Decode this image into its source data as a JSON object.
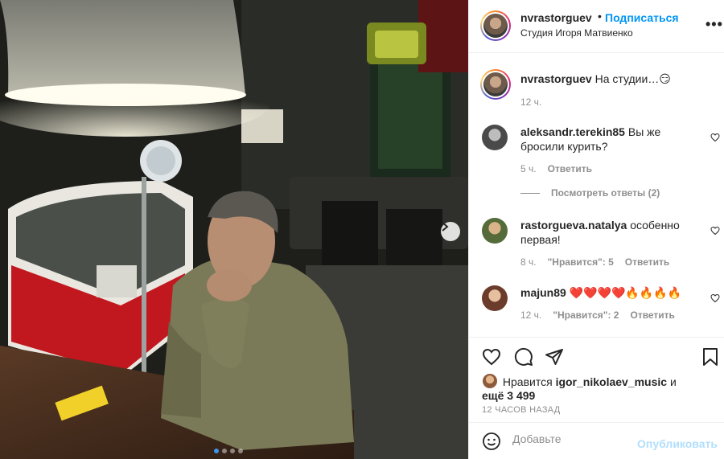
{
  "post": {
    "username": "nvrastorguev",
    "follow_label": "Подписаться",
    "separator": "•",
    "location": "Студия Игоря Матвиенко",
    "more_label": "•••"
  },
  "caption": {
    "username": "nvrastorguev",
    "text": "На студии…",
    "emoji": "😏",
    "time": "12 ч."
  },
  "comments": [
    {
      "username": "aleksandr.terekin85",
      "text": "Вы же бросили курить?",
      "time": "5 ч.",
      "reply_label": "Ответить",
      "view_replies": "Посмотреть ответы (2)"
    },
    {
      "username": "rastorgueva.natalya",
      "text": "особенно первая!",
      "time": "8 ч.",
      "likes": "\"Нравится\": 5",
      "reply_label": "Ответить"
    },
    {
      "username": "majun89",
      "text": "❤️❤️❤️❤️🔥🔥🔥🔥",
      "time": "12 ч.",
      "likes": "\"Нравится\": 2",
      "reply_label": "Ответить"
    }
  ],
  "likes": {
    "prefix": "Нравится",
    "user": "igor_nikolaev_music",
    "and": "и",
    "more": "ещё 3 499"
  },
  "time_ago": "12 ЧАСОВ НАЗАД",
  "add_comment": {
    "placeholder": "Добавьте",
    "publish_label": "Опубликовать"
  },
  "carousel": {
    "total": 4,
    "active": 1
  },
  "colors": {
    "accent": "#0095f6",
    "secondary_text": "#8e8e8e",
    "publish_disabled": "#b2dffc"
  }
}
